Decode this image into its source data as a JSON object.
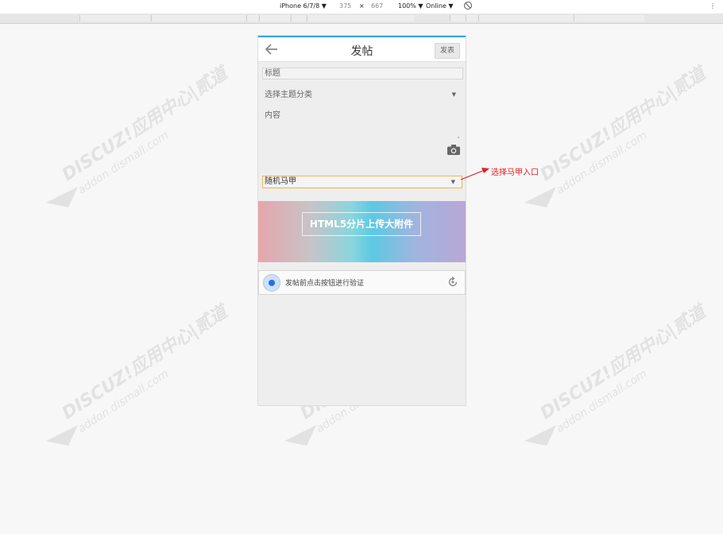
{
  "devtools": {
    "device": "iPhone 6/7/8 ▼",
    "width": "375",
    "times": "×",
    "height": "667",
    "zoom": "100% ▼",
    "network": "Online ▼",
    "more": "⋮"
  },
  "header": {
    "title": "发帖",
    "publish_label": "发表"
  },
  "form": {
    "title_placeholder": "标题",
    "category_label": "选择主题分类",
    "content_label": "内容",
    "majia_value": "随机马甲"
  },
  "banner": {
    "text": "HTML5分片上传大附件"
  },
  "verify": {
    "text": "发帖前点击按钮进行验证"
  },
  "annotation": {
    "text": "选择马甲入口"
  },
  "watermark": {
    "line1": "DISCUZ!应用中心|贰道",
    "line2": "addon.dismall.com"
  },
  "colors": {
    "accent": "#3aa6d8",
    "annotation": "#e02020",
    "highlight_border": "#f0b45a"
  }
}
